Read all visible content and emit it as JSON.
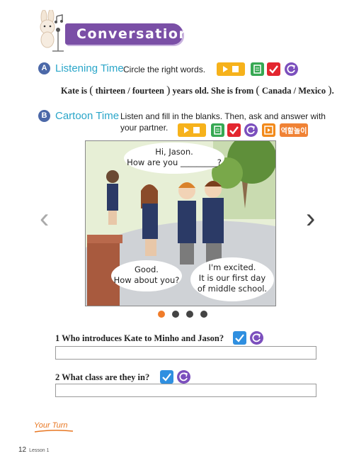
{
  "header": {
    "title": "Conversation"
  },
  "section_a": {
    "badge": "A",
    "title": "Listening Time",
    "instruction": "Circle the right words.",
    "sentence": {
      "part1": "Kate is",
      "choice1a": "thirteen",
      "choice1b": "fourteen",
      "part2": "years old.  She is from",
      "choice2a": "Canada",
      "choice2b": "Mexico",
      "end": "."
    }
  },
  "section_b": {
    "badge": "B",
    "title": "Cartoon Time",
    "instruction_line1": "Listen and fill in the blanks. Then, ask and answer with",
    "instruction_line2": "your partner.",
    "role_play_label": "역할놀이"
  },
  "comic": {
    "bubble1_line1": "Hi, Jason.",
    "bubble1_line2": "How are you _________?",
    "bubble2_line1": "Good.",
    "bubble2_line2": "How about you?",
    "bubble3_line1": "I'm excited.",
    "bubble3_line2": "It is our first day",
    "bubble3_line3": "of middle school."
  },
  "carousel": {
    "prev": "‹",
    "next": "›",
    "dots": 4,
    "active": 1
  },
  "questions": [
    {
      "number": "1",
      "text": "Who introduces Kate to Minho and Jason?"
    },
    {
      "number": "2",
      "text": "What class are they in?"
    }
  ],
  "your_turn": "Your Turn",
  "footer": {
    "page": "12",
    "lesson": "Lesson 1"
  },
  "colors": {
    "banner": "#7a4fa6",
    "section_title": "#2aa6c9",
    "play": "#f6b21b",
    "script": "#36a852",
    "check": "#e3262f",
    "replay": "#7b4fbd",
    "video": "#f28a1b",
    "active_dot": "#f07c2a"
  },
  "icons": [
    "rabbit-mascot-icon",
    "music-note-icon",
    "play-icon",
    "script-icon",
    "check-icon",
    "replay-icon",
    "video-icon"
  ]
}
